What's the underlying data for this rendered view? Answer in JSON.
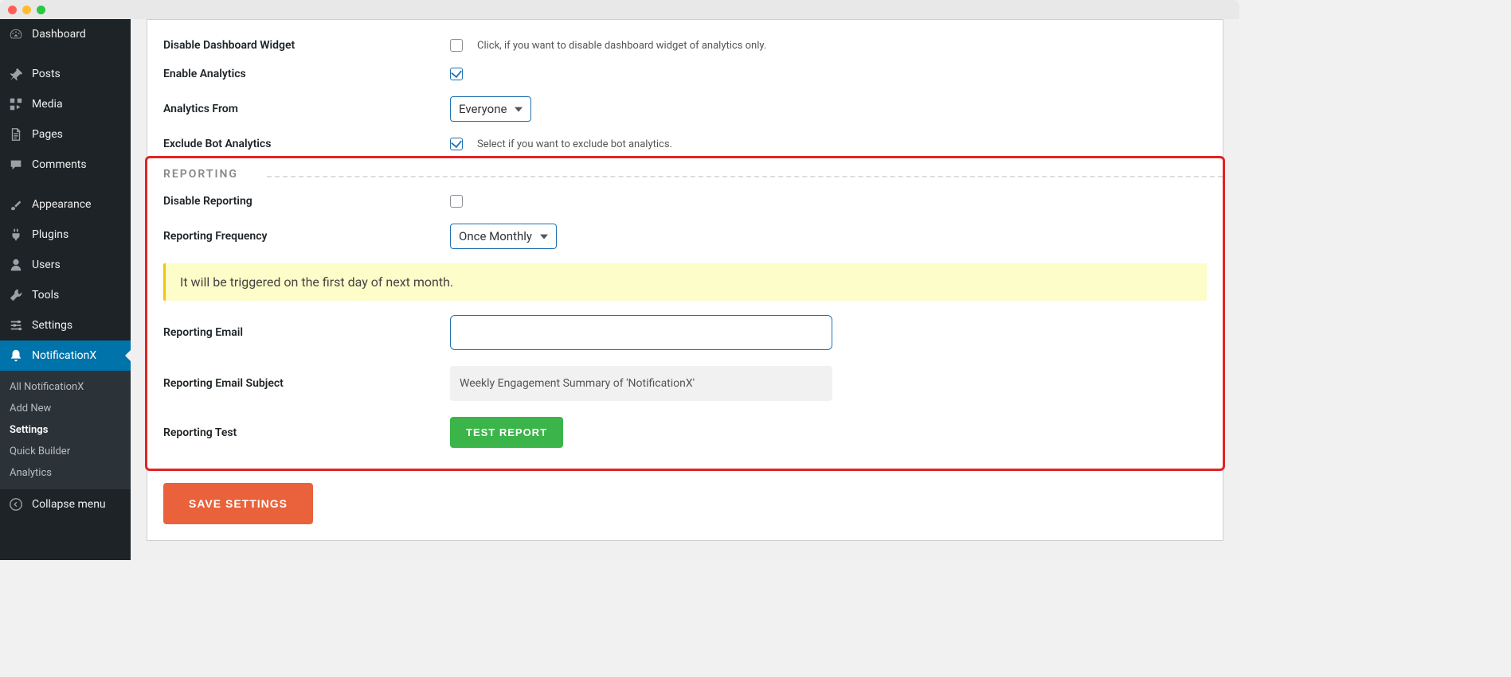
{
  "sidebar": {
    "items": [
      {
        "label": "Dashboard",
        "icon": "dashboard"
      },
      {
        "label": "Posts",
        "icon": "pin"
      },
      {
        "label": "Media",
        "icon": "media"
      },
      {
        "label": "Pages",
        "icon": "page"
      },
      {
        "label": "Comments",
        "icon": "comment"
      },
      {
        "label": "Appearance",
        "icon": "brush"
      },
      {
        "label": "Plugins",
        "icon": "plug"
      },
      {
        "label": "Users",
        "icon": "user"
      },
      {
        "label": "Tools",
        "icon": "wrench"
      },
      {
        "label": "Settings",
        "icon": "sliders"
      },
      {
        "label": "NotificationX",
        "icon": "bell"
      }
    ],
    "submenu": [
      {
        "label": "All NotificationX"
      },
      {
        "label": "Add New"
      },
      {
        "label": "Settings"
      },
      {
        "label": "Quick Builder"
      },
      {
        "label": "Analytics"
      }
    ],
    "collapse_label": "Collapse menu"
  },
  "analytics": {
    "disable_widget_label": "Disable Dashboard Widget",
    "disable_widget_help": "Click, if you want to disable dashboard widget of analytics only.",
    "enable_label": "Enable Analytics",
    "from_label": "Analytics From",
    "from_value": "Everyone",
    "exclude_label": "Exclude Bot Analytics",
    "exclude_help": "Select if you want to exclude bot analytics."
  },
  "reporting": {
    "header": "REPORTING",
    "disable_label": "Disable Reporting",
    "frequency_label": "Reporting Frequency",
    "frequency_value": "Once Monthly",
    "notice": "It will be triggered on the first day of next month.",
    "email_label": "Reporting Email",
    "email_value": "",
    "subject_label": "Reporting Email Subject",
    "subject_value": "Weekly Engagement Summary of 'NotificationX'",
    "test_label": "Reporting Test",
    "test_button": "TEST REPORT"
  },
  "save_button": "SAVE SETTINGS"
}
